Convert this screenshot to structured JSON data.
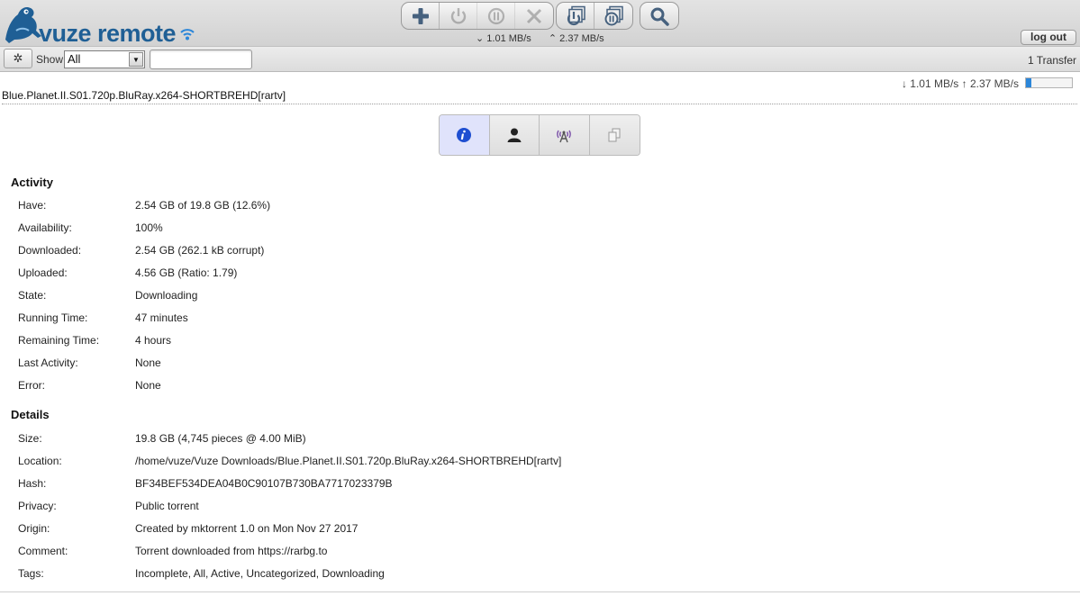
{
  "app": {
    "logo_text": "vuze remote",
    "brand_color": "#1f5f95",
    "accent_color": "#2b86d9"
  },
  "toolbar": {
    "group1": [
      {
        "name": "add-torrent",
        "icon": "plus-icon",
        "enabled": true
      },
      {
        "name": "start",
        "icon": "power-icon",
        "enabled": false
      },
      {
        "name": "pause",
        "icon": "pause-icon",
        "enabled": false
      },
      {
        "name": "remove",
        "icon": "x-icon",
        "enabled": false
      }
    ],
    "group2": [
      {
        "name": "start-all",
        "icon": "power-all-icon",
        "enabled": true
      },
      {
        "name": "pause-all",
        "icon": "pause-all-icon",
        "enabled": true
      }
    ],
    "group3": [
      {
        "name": "search",
        "icon": "magnifier-icon",
        "enabled": true
      }
    ]
  },
  "speeds": {
    "download": "1.01 MB/s",
    "upload": "2.37 MB/s"
  },
  "header": {
    "logout_label": "log out"
  },
  "filterbar": {
    "settings_icon": "gear-icon",
    "show_label": "Show",
    "show_value": "All",
    "filter_placeholder": "",
    "transfer_count": "1 Transfer"
  },
  "torrent": {
    "rates": "↓ 1.01 MB/s ↑ 2.37 MB/s",
    "progress_percent": 12.6,
    "name": "Blue.Planet.II.S01.720p.BluRay.x264-SHORTBREHD[rartv]"
  },
  "tabs": [
    {
      "name": "info",
      "icon": "info-icon",
      "active": true
    },
    {
      "name": "peers",
      "icon": "person-icon",
      "active": false
    },
    {
      "name": "trackers",
      "icon": "antenna-icon",
      "active": false
    },
    {
      "name": "files",
      "icon": "files-icon",
      "active": false
    }
  ],
  "activity": {
    "title": "Activity",
    "rows": [
      {
        "key": "Have:",
        "value": "2.54 GB of 19.8 GB (12.6%)"
      },
      {
        "key": "Availability:",
        "value": "100%"
      },
      {
        "key": "Downloaded:",
        "value": "2.54 GB (262.1 kB corrupt)"
      },
      {
        "key": "Uploaded:",
        "value": "4.56 GB (Ratio: 1.79)"
      },
      {
        "key": "State:",
        "value": "Downloading"
      },
      {
        "key": "Running Time:",
        "value": "47 minutes"
      },
      {
        "key": "Remaining Time:",
        "value": "4 hours"
      },
      {
        "key": "Last Activity:",
        "value": "None"
      },
      {
        "key": "Error:",
        "value": "None"
      }
    ]
  },
  "details": {
    "title": "Details",
    "rows": [
      {
        "key": "Size:",
        "value": "19.8 GB (4,745 pieces @ 4.00 MiB)"
      },
      {
        "key": "Location:",
        "value": "/home/vuze/Vuze Downloads/Blue.Planet.II.S01.720p.BluRay.x264-SHORTBREHD[rartv]"
      },
      {
        "key": "Hash:",
        "value": "BF34BEF534DEA04B0C90107B730BA7717023379B"
      },
      {
        "key": "Privacy:",
        "value": "Public torrent"
      },
      {
        "key": "Origin:",
        "value": "Created by mktorrent 1.0 on Mon Nov 27 2017"
      },
      {
        "key": "Comment:",
        "value": "Torrent downloaded from https://rarbg.to"
      },
      {
        "key": "Tags:",
        "value": "Incomplete, All, Active, Uncategorized, Downloading"
      }
    ]
  }
}
